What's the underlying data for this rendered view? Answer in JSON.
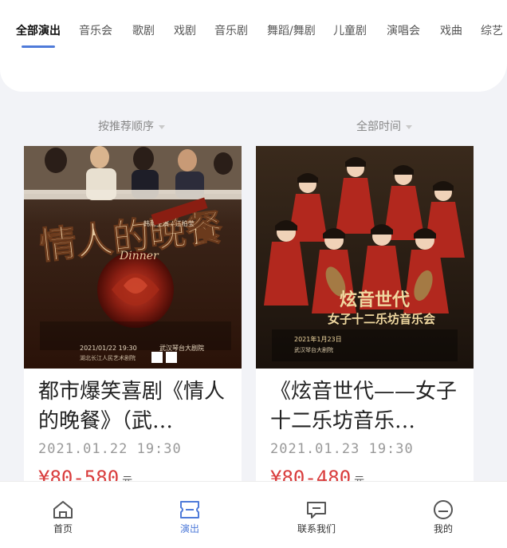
{
  "tabs": [
    {
      "label": "全部演出",
      "active": true
    },
    {
      "label": "音乐会"
    },
    {
      "label": "歌剧"
    },
    {
      "label": "戏剧"
    },
    {
      "label": "音乐剧"
    },
    {
      "label": "舞蹈/舞剧"
    },
    {
      "label": "儿童剧"
    },
    {
      "label": "演唱会"
    },
    {
      "label": "戏曲"
    },
    {
      "label": "综艺"
    }
  ],
  "filters": {
    "sort_label": "按推荐顺序",
    "time_label": "全部时间"
  },
  "cards": [
    {
      "title": "都市爆笑喜剧《情人的晚餐》（武汉站）",
      "title_display": "都市爆笑喜剧《情人的晚餐》（武…",
      "date": "2021.01.22 19:30",
      "price": "¥80-580",
      "price_unit": "元",
      "poster": {
        "headline": "情人的晚餐",
        "subline": "Dinner",
        "credit": "韩雨主演 / 江柏莹",
        "date_text": "2021/01/22 19:30",
        "venue_text": "武汉琴台大剧院",
        "sponsor_text": "湖北长江人民艺术剧院"
      }
    },
    {
      "title": "《炫音世代——女子十二乐坊音乐会》",
      "title_display": "《炫音世代——女子十二乐坊音乐…",
      "date": "2021.01.23 19:30",
      "price": "¥80-480",
      "price_unit": "元",
      "poster": {
        "headline": "炫音世代",
        "subline": "女子十二乐坊音乐会",
        "date_text": "2021年1月23日",
        "venue_text": "武汉琴台大剧院"
      }
    }
  ],
  "bottom_nav": [
    {
      "label": "首页",
      "icon": "home-icon"
    },
    {
      "label": "演出",
      "icon": "ticket-icon",
      "active": true
    },
    {
      "label": "联系我们",
      "icon": "message-icon"
    },
    {
      "label": "我的",
      "icon": "user-icon"
    }
  ],
  "colors": {
    "accent": "#4f7bd9",
    "price": "#d93c3c",
    "page_bg": "#f2f3f7"
  }
}
